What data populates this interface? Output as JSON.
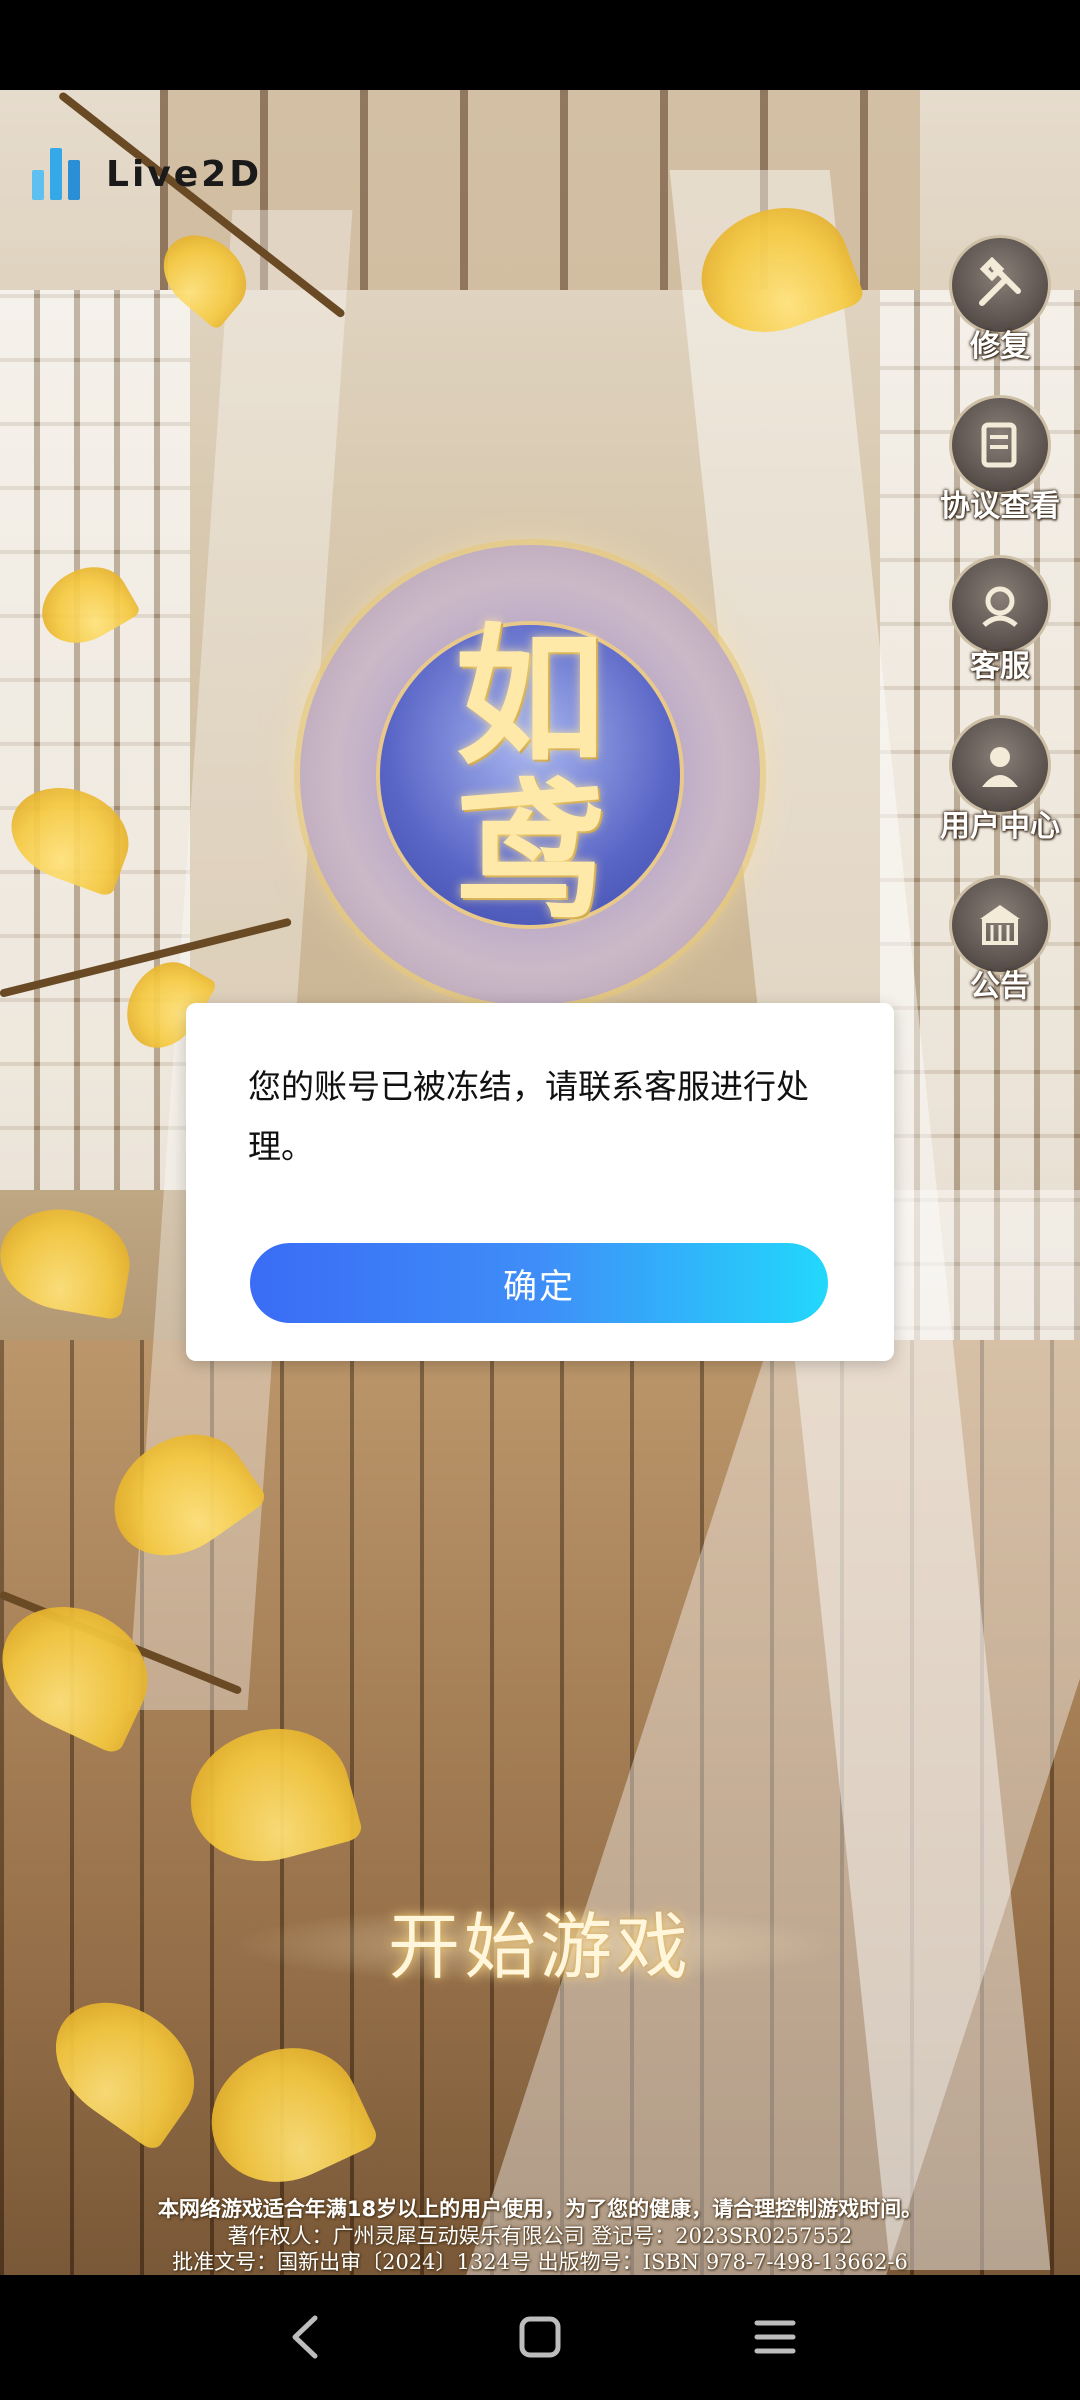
{
  "branding": {
    "logo_text": "Live2D",
    "game_title_line1": "如",
    "game_title_line2": "鸢"
  },
  "side_menu": [
    {
      "label": "修复",
      "icon": "repair-tools-icon"
    },
    {
      "label": "协议查看",
      "icon": "agreement-scroll-icon"
    },
    {
      "label": "客服",
      "icon": "customer-service-icon"
    },
    {
      "label": "用户中心",
      "icon": "user-center-icon"
    },
    {
      "label": "公告",
      "icon": "announcement-building-icon"
    }
  ],
  "dialog": {
    "message": "您的账号已被冻结，请联系客服进行处理。",
    "confirm_label": "确定"
  },
  "start_game_label": "开始游戏",
  "footer": {
    "age_notice": "本网络游戏适合年满18岁以上的用户使用，为了您的健康，请合理控制游戏时间。",
    "copyright": "著作权人：广州灵犀互动娱乐有限公司  登记号：2023SR0257552",
    "approval": "批准文号：国新出审〔2024〕1324号  出版物号：ISBN 978-7-498-13662-6"
  },
  "colors": {
    "confirm_gradient_start": "#3a6cf5",
    "confirm_gradient_end": "#22d8fb",
    "dialog_background": "#ffffff"
  },
  "navigation": {
    "back_icon": "back-chevron-icon",
    "home_icon": "home-square-icon",
    "menu_icon": "menu-lines-icon"
  }
}
